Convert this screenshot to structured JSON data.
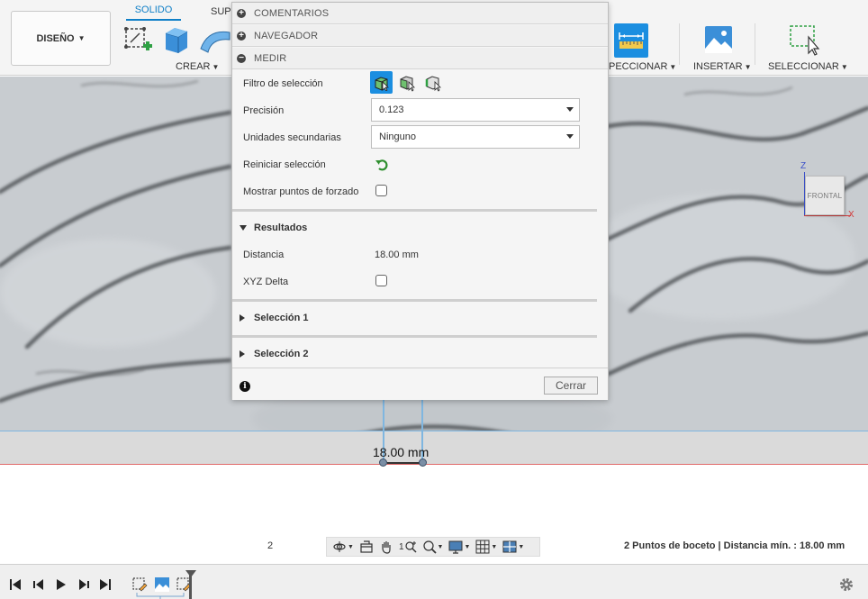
{
  "toolbar": {
    "design_label": "DISEÑO",
    "tab_solid": "SOLIDO",
    "tab_surface": "SUP",
    "group_create": "CREAR",
    "group_inspect": "PECCIONAR",
    "group_insert": "INSERTAR",
    "group_select": "SELECCIONAR"
  },
  "panel": {
    "rows": {
      "comments": "COMENTARIOS",
      "navigator": "NAVEGADOR",
      "measure": "MEDIR"
    },
    "selection_filter_label": "Filtro de selección",
    "precision_label": "Precisión",
    "precision_value": "0.123",
    "secondary_units_label": "Unidades secundarias",
    "secondary_units_value": "Ninguno",
    "reset_selection_label": "Reiniciar selección",
    "show_snap_points_label": "Mostrar puntos de forzado",
    "results_header": "Resultados",
    "distance_label": "Distancia",
    "distance_value": "18.00 mm",
    "xyz_delta_label": "XYZ Delta",
    "selection1_header": "Selección 1",
    "selection2_header": "Selección 2",
    "close_label": "Cerrar"
  },
  "viewcube": {
    "face_label": "FRONTAL",
    "axis_z": "Z",
    "axis_x": "X"
  },
  "canvas": {
    "dimension_label": "18.00 mm"
  },
  "statusbar": {
    "page_number": "2",
    "nav_zoom_label": "1",
    "status_text": "2 Puntos de boceto | Distancia mín. : 18.00 mm"
  },
  "colors": {
    "accent": "#0f7fc7",
    "filter_active": "#1b8ee0",
    "canvas_bg": "#c9cdd0",
    "dimension_line": "#7fb6e0",
    "axis_z": "#3a4fc9",
    "axis_x": "#d23c3c",
    "reset_icon": "#3aa43a"
  },
  "icons": [
    "sketch-icon",
    "extrude-icon",
    "surface-icon",
    "measure-icon",
    "insert-image-icon",
    "select-icon",
    "info-icon",
    "gear-icon",
    "reset-icon",
    "orbit-icon",
    "pan-icon",
    "zoom-icon",
    "display-icon",
    "grid-icon",
    "viewport-icon"
  ]
}
